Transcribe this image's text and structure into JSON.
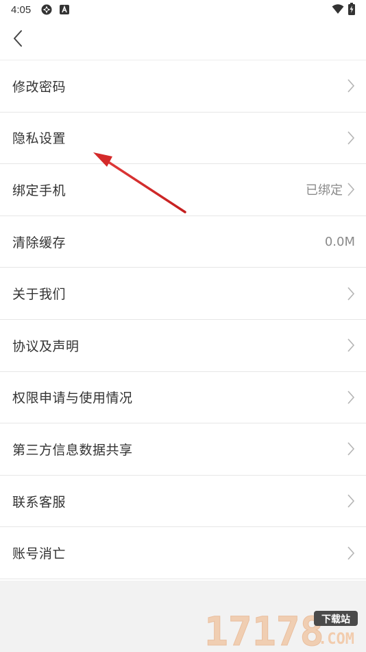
{
  "status_bar": {
    "time": "4:05",
    "icons": [
      "sync-icon",
      "app-a-icon",
      "wifi-icon",
      "battery-charging-icon"
    ]
  },
  "nav": {
    "back_icon": "chevron-left-icon"
  },
  "menu": {
    "items": [
      {
        "label": "修改密码",
        "value": "",
        "chevron": true
      },
      {
        "label": "隐私设置",
        "value": "",
        "chevron": true
      },
      {
        "label": "绑定手机",
        "value": "已绑定",
        "chevron": true
      },
      {
        "label": "清除缓存",
        "value": "0.0M",
        "chevron": false
      },
      {
        "label": "关于我们",
        "value": "",
        "chevron": true
      },
      {
        "label": "协议及声明",
        "value": "",
        "chevron": true
      },
      {
        "label": "权限申请与使用情况",
        "value": "",
        "chevron": true
      },
      {
        "label": "第三方信息数据共享",
        "value": "",
        "chevron": true
      },
      {
        "label": "联系客服",
        "value": "",
        "chevron": true
      },
      {
        "label": "账号消亡",
        "value": "",
        "chevron": true
      }
    ]
  },
  "colors": {
    "annotation": "#d42a2a",
    "divider": "#e6e6e6",
    "text": "#333333",
    "secondary": "#8a8a8a"
  },
  "watermark": {
    "number": "17178",
    "tag": "下载站",
    "suffix": ".COM"
  }
}
